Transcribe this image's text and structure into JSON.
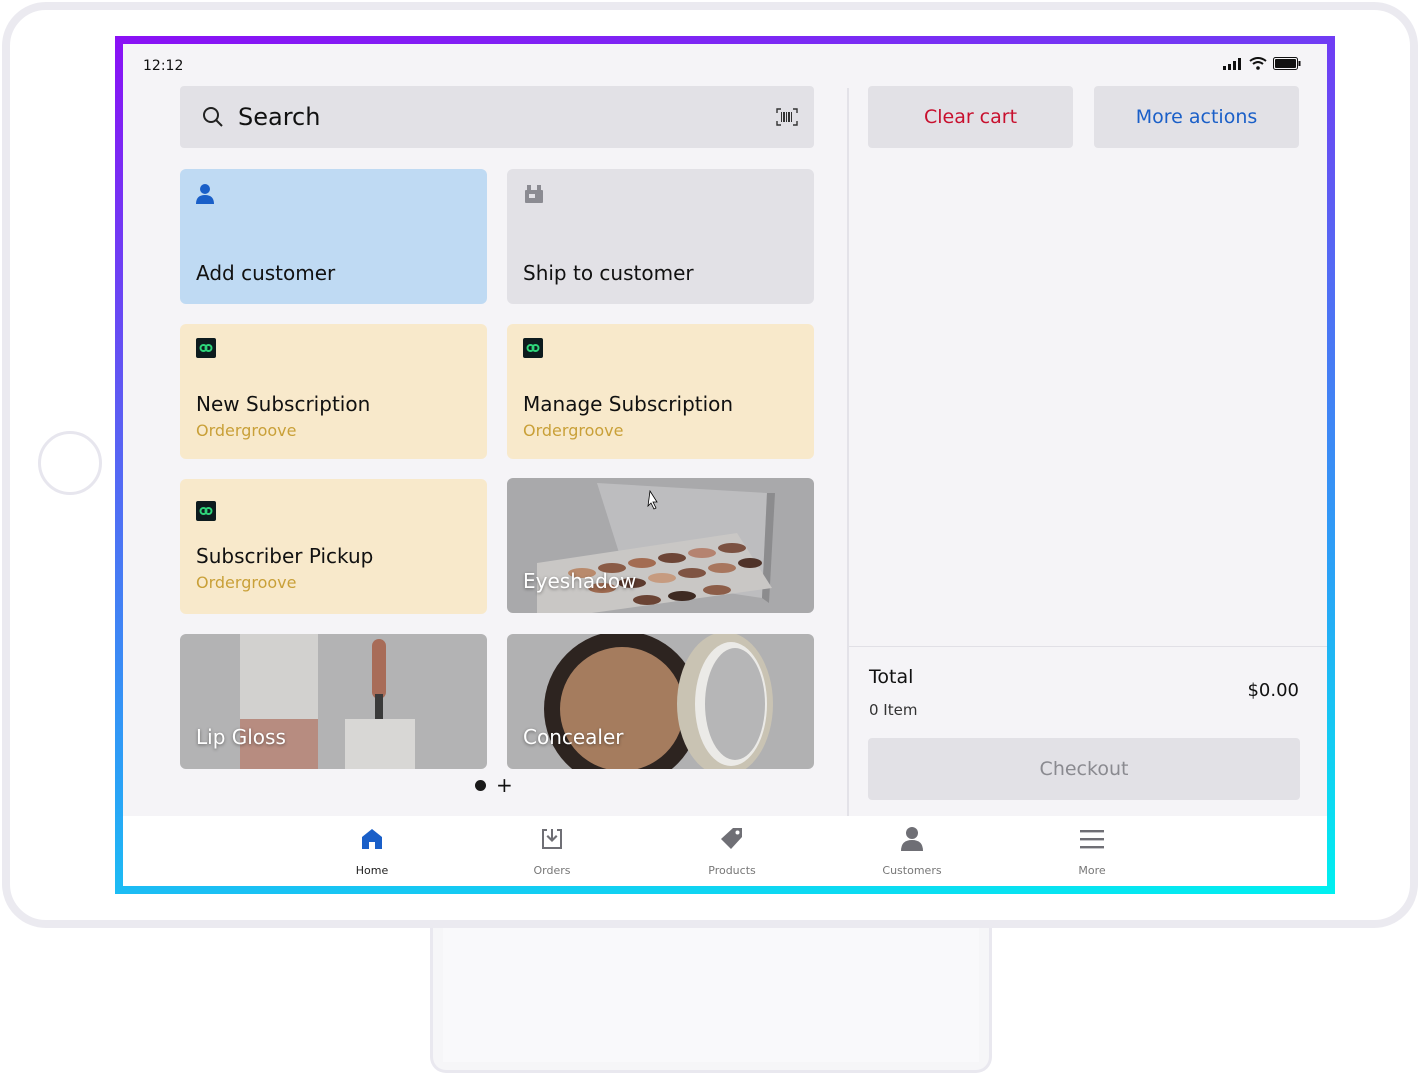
{
  "status_bar": {
    "time": "12:12"
  },
  "search": {
    "label": "Search"
  },
  "tiles": [
    {
      "title": "Add customer",
      "icon": "person-icon"
    },
    {
      "title": "Ship to customer",
      "icon": "package-icon"
    },
    {
      "title": "New Subscription",
      "subtitle": "Ordergroove",
      "icon": "ordergroove-icon"
    },
    {
      "title": "Manage Subscription",
      "subtitle": "Ordergroove",
      "icon": "ordergroove-icon"
    },
    {
      "title": "Subscriber Pickup",
      "subtitle": "Ordergroove",
      "icon": "ordergroove-icon"
    },
    {
      "title": "Eyeshadow"
    },
    {
      "title": "Lip Gloss"
    },
    {
      "title": "Concealer"
    }
  ],
  "pager": {
    "plus": "+"
  },
  "cart": {
    "clear_label": "Clear cart",
    "more_actions_label": "More actions",
    "total_label": "Total",
    "item_count": "0 Item",
    "total_value": "$0.00",
    "checkout_label": "Checkout"
  },
  "nav": [
    {
      "label": "Home",
      "icon": "home-icon"
    },
    {
      "label": "Orders",
      "icon": "orders-icon"
    },
    {
      "label": "Products",
      "icon": "tag-icon"
    },
    {
      "label": "Customers",
      "icon": "person-icon"
    },
    {
      "label": "More",
      "icon": "menu-icon"
    }
  ],
  "colors": {
    "accent_blue": "#1a5fc8",
    "danger_red": "#c8102e",
    "ordergroove_gold": "#c9a038",
    "frame_gradient_start": "#8a10f5",
    "frame_gradient_end": "#00f0f0"
  }
}
